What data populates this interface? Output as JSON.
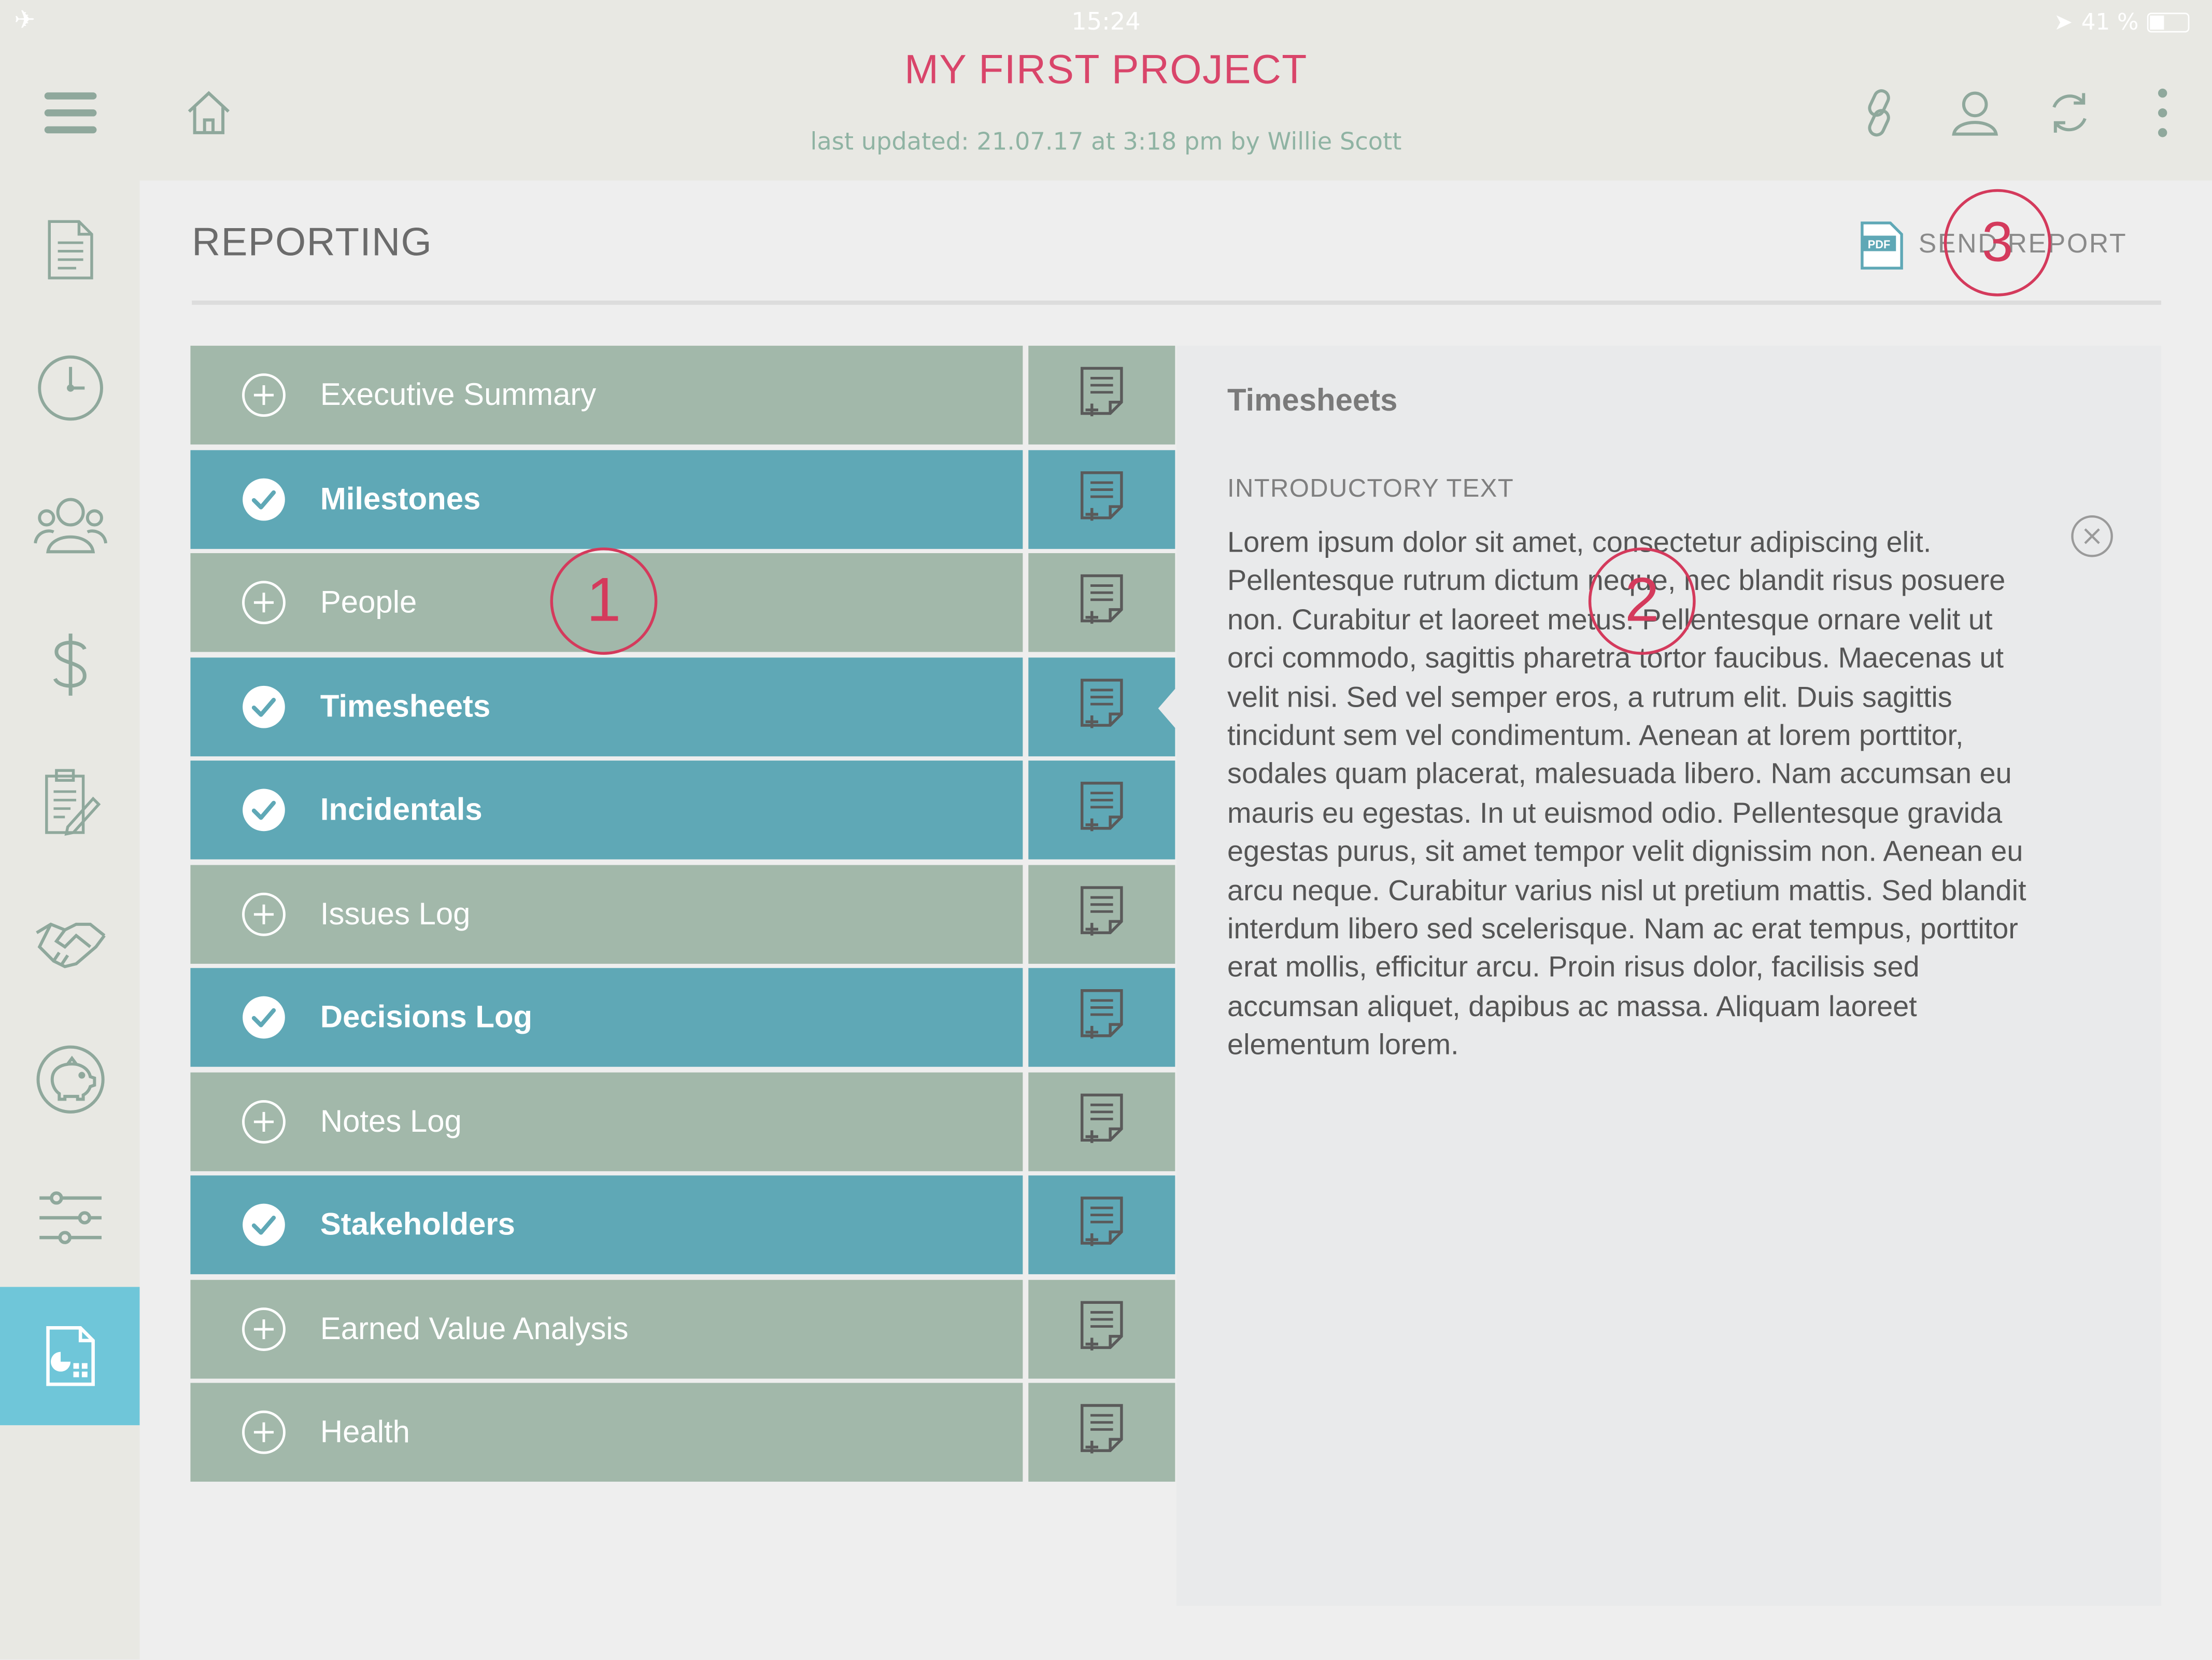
{
  "status_bar": {
    "time": "15:24",
    "battery": "41 %"
  },
  "header": {
    "project_title": "MY FIRST PROJECT",
    "last_updated": "last updated: 21.07.17 at 3:18 pm by Willie Scott"
  },
  "sidebar": {
    "items": [
      {
        "icon": "document-icon"
      },
      {
        "icon": "clock-icon"
      },
      {
        "icon": "people-icon"
      },
      {
        "icon": "dollar-icon"
      },
      {
        "icon": "clipboard-edit-icon"
      },
      {
        "icon": "handshake-icon"
      },
      {
        "icon": "piggy-bank-icon"
      },
      {
        "icon": "sliders-icon"
      },
      {
        "icon": "report-icon",
        "active": true
      }
    ]
  },
  "main": {
    "title": "REPORTING",
    "send_report": {
      "badge": "PDF",
      "label": "SEND REPORT"
    }
  },
  "sections": [
    {
      "label": "Executive Summary",
      "included": false
    },
    {
      "label": "Milestones",
      "included": true
    },
    {
      "label": "People",
      "included": false
    },
    {
      "label": "Timesheets",
      "included": true,
      "selected": true
    },
    {
      "label": "Incidentals",
      "included": true
    },
    {
      "label": "Issues Log",
      "included": false
    },
    {
      "label": "Decisions Log",
      "included": true
    },
    {
      "label": "Notes Log",
      "included": false
    },
    {
      "label": "Stakeholders",
      "included": true
    },
    {
      "label": "Earned Value Analysis",
      "included": false
    },
    {
      "label": "Health",
      "included": false
    }
  ],
  "detail": {
    "title": "Timesheets",
    "section_label": "INTRODUCTORY TEXT",
    "body": "Lorem ipsum dolor sit amet, consectetur adipiscing elit. Pellentesque rutrum dictum neque, nec blandit risus posuere non. Curabitur et laoreet metus. Pellentesque ornare velit ut orci commodo, sagittis pharetra tortor faucibus. Maecenas ut velit nisi. Sed vel semper eros, a rutrum elit. Duis sagittis tincidunt sem vel condimentum. Aenean at lorem porttitor, sodales quam placerat, malesuada libero. Nam accumsan eu mauris eu egestas. In ut euismod odio. Pellentesque gravida egestas purus, sit amet tempor velit dignissim non. Aenean eu arcu neque. Curabitur varius nisl ut pretium mattis. Sed blandit interdum libero sed scelerisque. Nam ac erat tempus, porttitor erat mollis, efficitur arcu. Proin risus dolor, facilisis sed accumsan aliquet, dapibus ac massa. Aliquam laoreet elementum lorem."
  },
  "callouts": [
    "1",
    "2",
    "3"
  ],
  "colors": {
    "brand_pink": "#d9456a",
    "included_row": "#5fa8b6",
    "excluded_row": "#a2b8aa",
    "active_sidebar": "#6fc6d9"
  }
}
